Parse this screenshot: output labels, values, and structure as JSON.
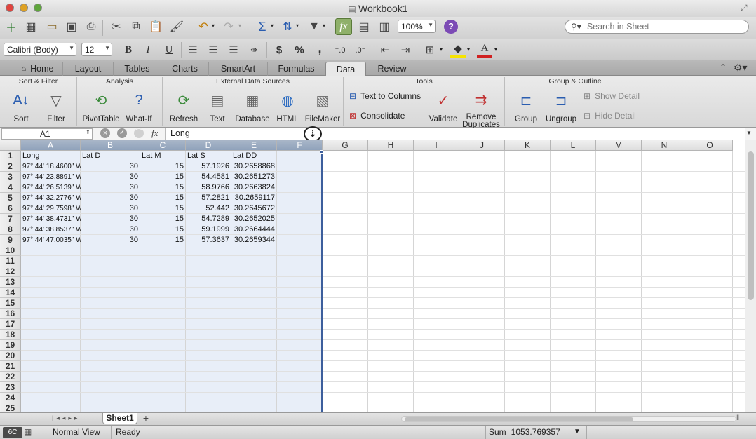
{
  "window": {
    "title": "Workbook1"
  },
  "toolbar": {
    "zoom": "100%",
    "search_placeholder": "Search in Sheet"
  },
  "format": {
    "font_name": "Calibri (Body)",
    "font_size": "12",
    "bold": "B",
    "italic": "I",
    "underline": "U",
    "currency": "$",
    "percent": "%",
    "comma": ","
  },
  "ribbon": {
    "tabs": [
      "Home",
      "Layout",
      "Tables",
      "Charts",
      "SmartArt",
      "Formulas",
      "Data",
      "Review"
    ],
    "active_tab": "Data",
    "groups": {
      "sort_filter": {
        "label": "Sort & Filter",
        "sort": "Sort",
        "filter": "Filter"
      },
      "analysis": {
        "label": "Analysis",
        "pivottable": "PivotTable",
        "whatif": "What-If"
      },
      "external": {
        "label": "External Data Sources",
        "refresh": "Refresh",
        "text": "Text",
        "database": "Database",
        "html": "HTML",
        "filemaker": "FileMaker"
      },
      "tools": {
        "label": "Tools",
        "text_to_columns": "Text to Columns",
        "consolidate": "Consolidate",
        "validate": "Validate",
        "remove_duplicates_1": "Remove",
        "remove_duplicates_2": "Duplicates"
      },
      "group_outline": {
        "label": "Group & Outline",
        "group": "Group",
        "ungroup": "Ungroup",
        "show_detail": "Show Detail",
        "hide_detail": "Hide Detail"
      }
    }
  },
  "formula_bar": {
    "cell_ref": "A1",
    "fx": "fx",
    "content": "Long"
  },
  "sheet": {
    "columns": [
      "A",
      "B",
      "C",
      "D",
      "E",
      "F",
      "G",
      "H",
      "I",
      "J",
      "K",
      "L",
      "M",
      "N",
      "O"
    ],
    "row_numbers": [
      "1",
      "2",
      "3",
      "4",
      "5",
      "6",
      "7",
      "8",
      "9",
      "10",
      "11",
      "12",
      "13",
      "14",
      "15",
      "16",
      "17",
      "18",
      "19",
      "20",
      "21",
      "22",
      "23",
      "24",
      "25"
    ],
    "rows": [
      [
        "Long",
        "Lat D",
        "Lat M",
        "Lat S",
        "Lat DD"
      ],
      [
        "97° 44' 18.4600\" W",
        "30",
        "15",
        "57.1926",
        "30.2658868"
      ],
      [
        "97° 44' 23.8891\" W",
        "30",
        "15",
        "54.4581",
        "30.2651273"
      ],
      [
        "97° 44' 26.5139\" W",
        "30",
        "15",
        "58.9766",
        "30.2663824"
      ],
      [
        "97° 44' 32.2776\" W",
        "30",
        "15",
        "57.2821",
        "30.2659117"
      ],
      [
        "97° 44' 29.7598\" W",
        "30",
        "15",
        "52.442",
        "30.2645672"
      ],
      [
        "97° 44' 38.4731\" W",
        "30",
        "15",
        "54.7289",
        "30.2652025"
      ],
      [
        "97° 44' 38.8537\" W",
        "30",
        "15",
        "59.1999",
        "30.2664444"
      ],
      [
        "97° 44' 47.0035\" W",
        "30",
        "15",
        "57.3637",
        "30.2659344"
      ]
    ]
  },
  "sheet_tabs": {
    "active": "Sheet1",
    "add": "+"
  },
  "status": {
    "view": "Normal View",
    "state": "Ready",
    "sum": "Sum=1053.769357",
    "badge": "6C"
  }
}
